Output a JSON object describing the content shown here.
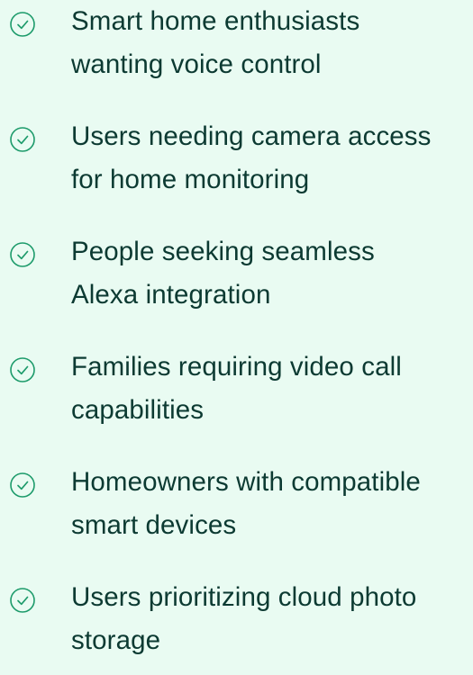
{
  "colors": {
    "background": "#e9fbf2",
    "text": "#0c3a32",
    "icon": "#1d9b6b"
  },
  "items": [
    {
      "icon": "check-circle-icon",
      "lines": [
        "Smart home enthusiasts",
        "wanting voice control"
      ]
    },
    {
      "icon": "check-circle-icon",
      "lines": [
        "Users needing camera access",
        "for home monitoring"
      ]
    },
    {
      "icon": "check-circle-icon",
      "lines": [
        "People seeking seamless",
        "Alexa integration"
      ]
    },
    {
      "icon": "check-circle-icon",
      "lines": [
        "Families requiring video call",
        "capabilities"
      ]
    },
    {
      "icon": "check-circle-icon",
      "lines": [
        "Homeowners with compatible",
        "smart devices"
      ]
    },
    {
      "icon": "check-circle-icon",
      "lines": [
        "Users prioritizing cloud photo",
        "storage"
      ]
    }
  ]
}
